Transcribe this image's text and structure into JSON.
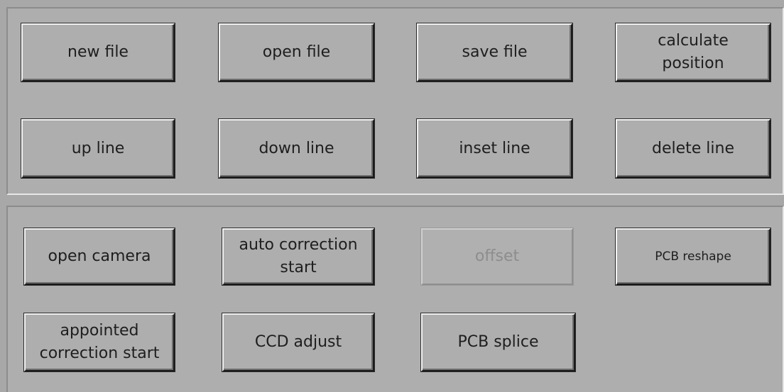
{
  "file_panel": {
    "new_file": "new file",
    "open_file": "open file",
    "save_file": "save file",
    "calculate_position": "calculate\nposition",
    "up_line": "up line",
    "down_line": "down line",
    "inset_line": "inset line",
    "delete_line": "delete line"
  },
  "camera_panel": {
    "open_camera": "open camera",
    "auto_correction_start": "auto correction\nstart",
    "offset": "offset",
    "offset_enabled": false,
    "pcb_reshape": "PCB reshape",
    "appointed_correction_start": "appointed\ncorrection start",
    "ccd_adjust": "CCD adjust",
    "pcb_splice": "PCB splice"
  }
}
